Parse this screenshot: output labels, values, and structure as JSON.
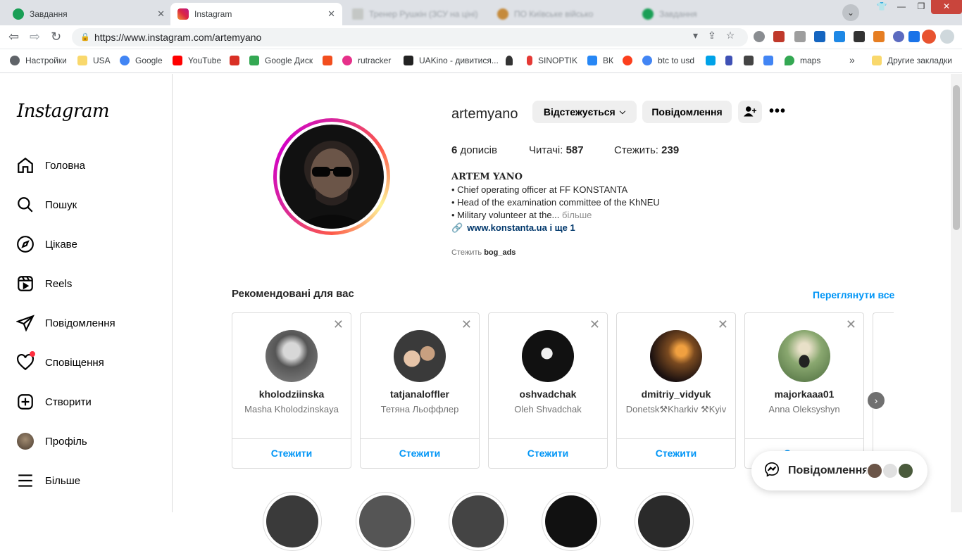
{
  "browser": {
    "tabs": [
      {
        "title": "Завдання",
        "icon": "tasks-icon",
        "color": "#1a9f56"
      },
      {
        "title": "Instagram",
        "icon": "instagram-icon",
        "color": "#e1306c"
      },
      {
        "title": "Тренер Рушкін (ЗСУ на ціні)",
        "icon": "page-icon",
        "color": "#9aa0a6"
      },
      {
        "title": "ПО Київське військо",
        "icon": "page-icon",
        "color": "#c58a3b"
      },
      {
        "title": "Завдання",
        "icon": "page-icon",
        "color": "#1a9f56"
      }
    ],
    "url": "https://www.instagram.com/artemyano",
    "bookmarks": [
      {
        "label": "Настройки",
        "icon": "gear-icon",
        "color": "#5f6368"
      },
      {
        "label": "USA",
        "icon": "folder-icon",
        "color": "#f9d86c"
      },
      {
        "label": "Google",
        "icon": "google-icon",
        "color": "#4285f4"
      },
      {
        "label": "YouTube",
        "icon": "youtube-icon",
        "color": "#ff0000"
      },
      {
        "label": "",
        "icon": "gmail-icon",
        "color": "#d93025"
      },
      {
        "label": "Google Диск",
        "icon": "drive-icon",
        "color": "#34a853"
      },
      {
        "label": "",
        "icon": "figma-icon",
        "color": "#f24e1e"
      },
      {
        "label": "rutracker",
        "icon": "rutracker-icon",
        "color": "#e6308a"
      },
      {
        "label": "UAKino - дивитися...",
        "icon": "uakino-icon",
        "color": "#222222"
      },
      {
        "label": "",
        "icon": "chess-icon",
        "color": "#333333"
      },
      {
        "label": "SINOPTIK",
        "icon": "thermometer-icon",
        "color": "#e53935"
      },
      {
        "label": "ВК",
        "icon": "vk-icon",
        "color": "#2787f5"
      },
      {
        "label": "",
        "icon": "yandex-icon",
        "color": "#fc3f1d"
      },
      {
        "label": "btc to usd",
        "icon": "google-icon",
        "color": "#4285f4"
      },
      {
        "label": "",
        "icon": "p-icon",
        "color": "#00a2e8"
      },
      {
        "label": "",
        "icon": "arrow-icon",
        "color": "#3f51b5"
      },
      {
        "label": "",
        "icon": "bc-icon",
        "color": "#444444"
      },
      {
        "label": "",
        "icon": "translate-icon",
        "color": "#4285f4"
      },
      {
        "label": "maps",
        "icon": "maps-icon",
        "color": "#34a853"
      }
    ],
    "other_bookmarks": "Другие закладки",
    "more_bookmarks": "»"
  },
  "instagram": {
    "logo": "Instagram",
    "nav": [
      {
        "label": "Головна",
        "icon": "home-icon"
      },
      {
        "label": "Пошук",
        "icon": "search-icon"
      },
      {
        "label": "Цікаве",
        "icon": "compass-icon"
      },
      {
        "label": "Reels",
        "icon": "reels-icon"
      },
      {
        "label": "Повідомлення",
        "icon": "messenger-icon"
      },
      {
        "label": "Сповіщення",
        "icon": "heart-icon"
      },
      {
        "label": "Створити",
        "icon": "create-icon"
      },
      {
        "label": "Профіль",
        "icon": "profile-avatar-icon"
      },
      {
        "label": "Більше",
        "icon": "menu-icon"
      }
    ],
    "profile": {
      "username": "artemyano",
      "following_button": "Відстежується",
      "message_button": "Повідомлення",
      "posts_count": "6",
      "posts_label": "дописів",
      "followers_label": "Читачі:",
      "followers_count": "587",
      "following_label": "Стежить:",
      "following_count": "239",
      "bio_name": "ARTEM YANO",
      "bio_lines": [
        "• Chief operating officer at FF KONSTANTA",
        "• Head of the examination committee of the KhNEU",
        "• Military volunteer at the..."
      ],
      "bio_more": "більше",
      "link_text": "www.konstanta.ua і ще 1",
      "followed_by_label": "Стежить",
      "followed_by_user": "bog_ads"
    },
    "recommended": {
      "title": "Рекомендовані для вас",
      "see_all": "Переглянути все",
      "follow_label": "Стежити",
      "cards": [
        {
          "username": "kholodziinska",
          "name": "Masha Kholodzinskaya",
          "avatar_color": "#8a8a8a"
        },
        {
          "username": "tatjanaloffler",
          "name": "Тетяна Льоффлер",
          "avatar_color": "#8a7560"
        },
        {
          "username": "oshvadchak",
          "name": "Oleh Shvadchak",
          "avatar_color": "#111111"
        },
        {
          "username": "dmitriy_vidyuk",
          "name": "Donetsk⚒Kharkiv ⚒Kyiv",
          "avatar_color": "#5a3a20"
        },
        {
          "username": "majorkaaa01",
          "name": "Anna Oleksyshyn",
          "avatar_color": "#6b8a5c"
        }
      ]
    },
    "messages_pill": "Повідомлення"
  }
}
